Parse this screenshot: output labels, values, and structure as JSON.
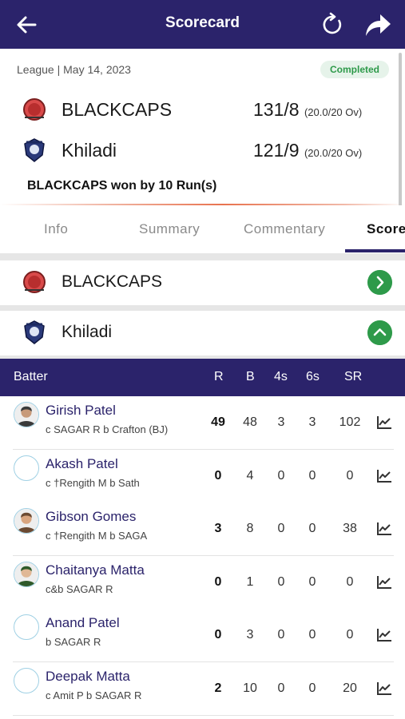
{
  "topbar": {
    "title": "Scorecard"
  },
  "match": {
    "meta": "League | May 14, 2023",
    "status": "Completed",
    "teams": [
      {
        "name": "BLACKCAPS",
        "score": "131/8",
        "overs": "(20.0/20 Ov)"
      },
      {
        "name": "Khiladi",
        "score": "121/9",
        "overs": "(20.0/20 Ov)"
      }
    ],
    "result": "BLACKCAPS won by 10 Run(s)"
  },
  "tabs": [
    "Info",
    "Summary",
    "Commentary",
    "Score"
  ],
  "innings": [
    {
      "name": "BLACKCAPS",
      "expanded": false
    },
    {
      "name": "Khiladi",
      "expanded": true
    }
  ],
  "table": {
    "headers": {
      "batter": "Batter",
      "r": "R",
      "b": "B",
      "fours": "4s",
      "sixes": "6s",
      "sr": "SR"
    },
    "rows": [
      {
        "name": "Girish Patel",
        "dismissal": "c SAGAR R b Crafton (BJ)",
        "r": "49",
        "b": "48",
        "fours": "3",
        "sixes": "3",
        "sr": "102",
        "avatar": "photo"
      },
      {
        "name": "Akash Patel",
        "dismissal": "c †Rengith M b Sath",
        "r": "0",
        "b": "4",
        "fours": "0",
        "sixes": "0",
        "sr": "0",
        "avatar": "placeholder"
      },
      {
        "name": "Gibson Gomes",
        "dismissal": "c †Rengith M b SAGA",
        "r": "3",
        "b": "8",
        "fours": "0",
        "sixes": "0",
        "sr": "38",
        "avatar": "photo"
      },
      {
        "name": "Chaitanya Matta",
        "dismissal": "c&b SAGAR R",
        "r": "0",
        "b": "1",
        "fours": "0",
        "sixes": "0",
        "sr": "0",
        "avatar": "photo"
      },
      {
        "name": "Anand Patel",
        "dismissal": "b SAGAR R",
        "r": "0",
        "b": "3",
        "fours": "0",
        "sixes": "0",
        "sr": "0",
        "avatar": "placeholder"
      },
      {
        "name": "Deepak Matta",
        "dismissal": "c Amit P b SAGAR R",
        "r": "2",
        "b": "10",
        "fours": "0",
        "sixes": "0",
        "sr": "20",
        "avatar": "placeholder"
      }
    ]
  },
  "colors": {
    "primary": "#2b236b",
    "success": "#2e9a4a",
    "accent": "#e8734f"
  }
}
